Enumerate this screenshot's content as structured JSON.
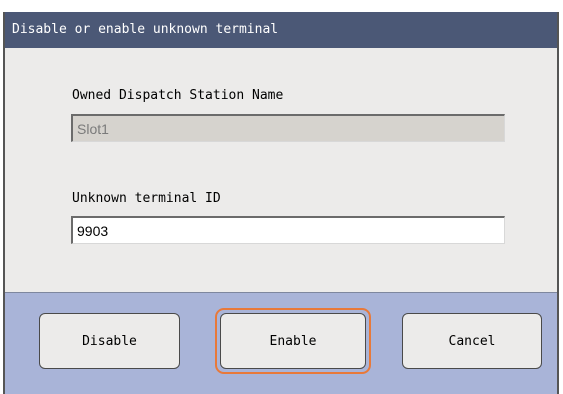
{
  "dialog": {
    "title": "Disable or enable unknown terminal"
  },
  "form": {
    "station_label": "Owned Dispatch Station Name",
    "station_value": "Slot1",
    "terminal_label": "Unknown terminal ID",
    "terminal_value": "9903"
  },
  "buttons": {
    "disable": "Disable",
    "enable": "Enable",
    "cancel": "Cancel"
  },
  "colors": {
    "titlebar": "#4b5876",
    "button_bar": "#a9b4d8",
    "focus_ring": "#e8793a"
  }
}
